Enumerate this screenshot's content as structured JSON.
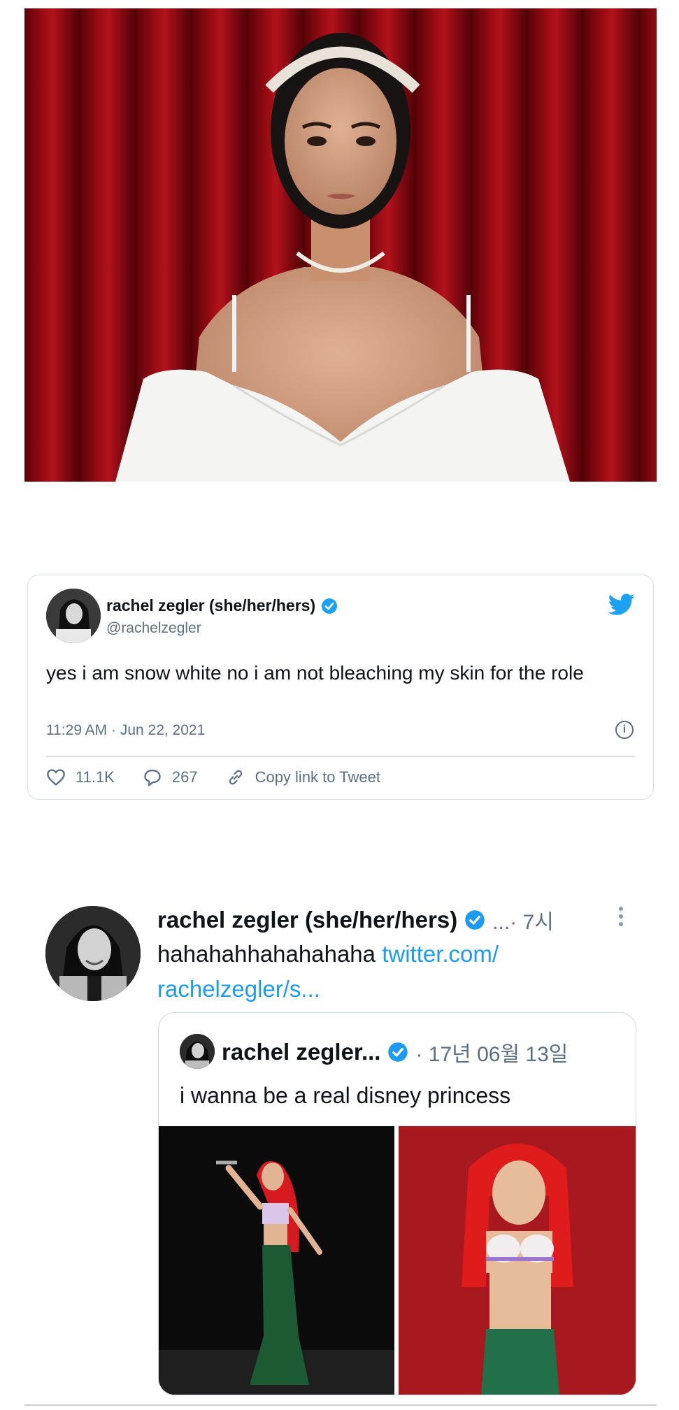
{
  "tweet_card": {
    "display_name": "rachel zegler (she/her/hers)",
    "handle": "@rachelzegler",
    "text": "yes i am snow white no i am not bleaching my skin for the role",
    "timestamp": "11:29 AM · Jun 22, 2021",
    "likes": "11.1K",
    "replies": "267",
    "copy_link_label": "Copy link to Tweet",
    "accent_color": "#1da1f2"
  },
  "mobile_tweet": {
    "display_name": "rachel zegler (she/her/hers)",
    "meta": "...· 7시",
    "text": "hahahahhahahahaha",
    "link": "twitter.com/ rachelzegler/s...",
    "quoted": {
      "display_name": "rachel zegler...",
      "date": "· 17년 06월 13일",
      "text": "i wanna be a real disney princess"
    }
  }
}
